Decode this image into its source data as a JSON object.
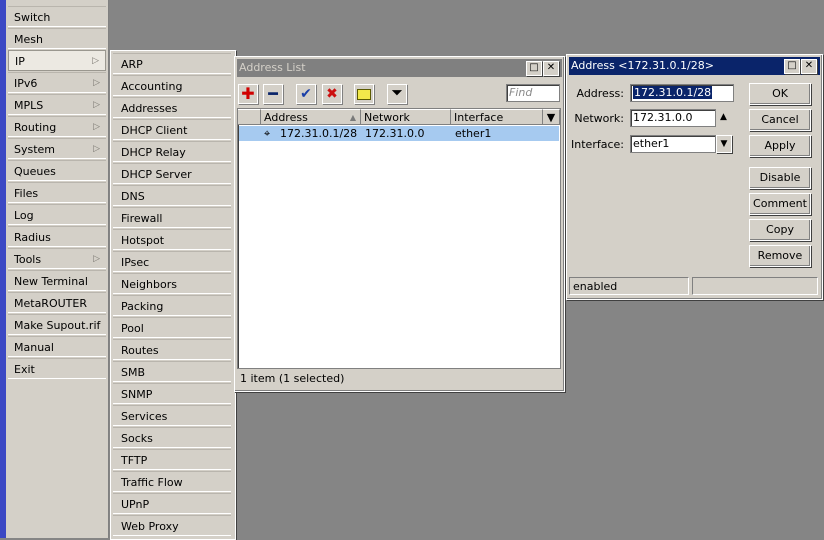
{
  "main_menu": {
    "items": [
      {
        "label": "Switch",
        "submenu": false
      },
      {
        "label": "Mesh",
        "submenu": false
      },
      {
        "label": "IP",
        "submenu": true,
        "selected": true
      },
      {
        "label": "IPv6",
        "submenu": true
      },
      {
        "label": "MPLS",
        "submenu": true
      },
      {
        "label": "Routing",
        "submenu": true
      },
      {
        "label": "System",
        "submenu": true
      },
      {
        "label": "Queues",
        "submenu": false
      },
      {
        "label": "Files",
        "submenu": false
      },
      {
        "label": "Log",
        "submenu": false
      },
      {
        "label": "Radius",
        "submenu": false
      },
      {
        "label": "Tools",
        "submenu": true
      },
      {
        "label": "New Terminal",
        "submenu": false
      },
      {
        "label": "MetaROUTER",
        "submenu": false
      },
      {
        "label": "Make Supout.rif",
        "submenu": false
      },
      {
        "label": "Manual",
        "submenu": false
      },
      {
        "label": "Exit",
        "submenu": false
      }
    ],
    "arrow": "▷"
  },
  "ip_submenu": {
    "items": [
      "ARP",
      "Accounting",
      "Addresses",
      "DHCP Client",
      "DHCP Relay",
      "DHCP Server",
      "DNS",
      "Firewall",
      "Hotspot",
      "IPsec",
      "Neighbors",
      "Packing",
      "Pool",
      "Routes",
      "SMB",
      "SNMP",
      "Services",
      "Socks",
      "TFTP",
      "Traffic Flow",
      "UPnP",
      "Web Proxy"
    ]
  },
  "address_list": {
    "title": "Address List",
    "find_placeholder": "Find",
    "columns": [
      "Address",
      "Network",
      "Interface"
    ],
    "rows": [
      {
        "address": "172.31.0.1/28",
        "network": "172.31.0.0",
        "interface": "ether1"
      }
    ],
    "status": "1 item (1 selected)"
  },
  "address_dialog": {
    "title": "Address <172.31.0.1/28>",
    "labels": {
      "address": "Address:",
      "network": "Network:",
      "interface": "Interface:"
    },
    "values": {
      "address": "172.31.0.1/28",
      "network": "172.31.0.0",
      "interface": "ether1"
    },
    "buttons": {
      "ok": "OK",
      "cancel": "Cancel",
      "apply": "Apply",
      "disable": "Disable",
      "comment": "Comment",
      "copy": "Copy",
      "remove": "Remove"
    },
    "status": "enabled"
  },
  "colors": {
    "accent": "#0a246a",
    "selection_row": "#a6caf0",
    "desktop": "#858585",
    "sidebar_strip": "#3b48c4"
  }
}
